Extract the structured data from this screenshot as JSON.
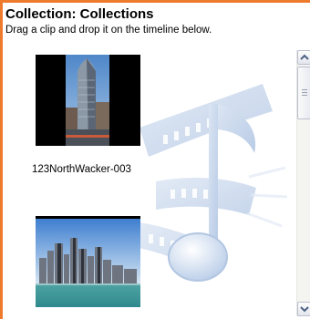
{
  "pane": {
    "title": "Collection: Collections",
    "hint": "Drag a clip and drop it on the timeline below."
  },
  "clips": [
    {
      "label": "123NorthWacker-003",
      "thumbnail": "skyscraper-photo"
    },
    {
      "label": "",
      "thumbnail": "city-skyline-photo"
    }
  ],
  "icons": {
    "watermark": "film-music-note-icon",
    "scroll_up": "arrow-up-icon",
    "scroll_down": "arrow-down-icon"
  },
  "colors": {
    "accent_border": "#ee7a2c",
    "watermark": "#c9d8ec"
  }
}
